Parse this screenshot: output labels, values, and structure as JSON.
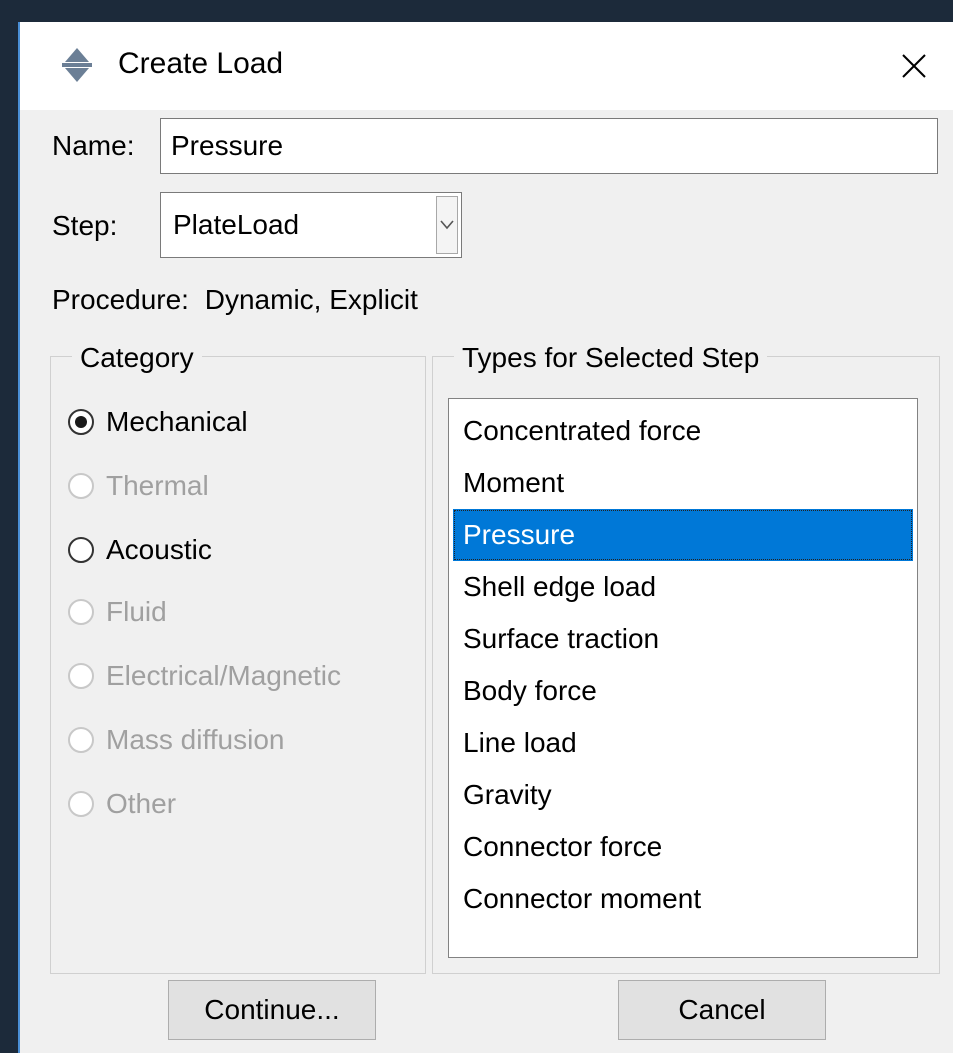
{
  "window": {
    "title": "Create Load",
    "icon": "load-icon",
    "close_glyph": "✕"
  },
  "form": {
    "name_label": "Name:",
    "name_value": "Pressure",
    "step_label": "Step:",
    "step_value": "PlateLoad",
    "procedure_label": "Procedure:",
    "procedure_value": "Dynamic, Explicit"
  },
  "category": {
    "title": "Category",
    "options": [
      {
        "label": "Mechanical",
        "checked": true,
        "enabled": true
      },
      {
        "label": "Thermal",
        "checked": false,
        "enabled": false
      },
      {
        "label": "Acoustic",
        "checked": false,
        "enabled": true
      },
      {
        "label": "Fluid",
        "checked": false,
        "enabled": false
      },
      {
        "label": "Electrical/Magnetic",
        "checked": false,
        "enabled": false
      },
      {
        "label": "Mass diffusion",
        "checked": false,
        "enabled": false
      },
      {
        "label": "Other",
        "checked": false,
        "enabled": false
      }
    ]
  },
  "types": {
    "title": "Types for Selected Step",
    "selected": "Pressure",
    "items": [
      "Concentrated force",
      "Moment",
      "Pressure",
      "Shell edge load",
      "Surface traction",
      "Body force",
      "Line load",
      "Gravity",
      "Connector force",
      "Connector moment"
    ]
  },
  "buttons": {
    "continue": "Continue...",
    "cancel": "Cancel"
  },
  "colors": {
    "selection": "#0078d7",
    "window_bg": "#f0f0f0",
    "title_bar": "#ffffff",
    "disabled_text": "#a0a0a0"
  }
}
